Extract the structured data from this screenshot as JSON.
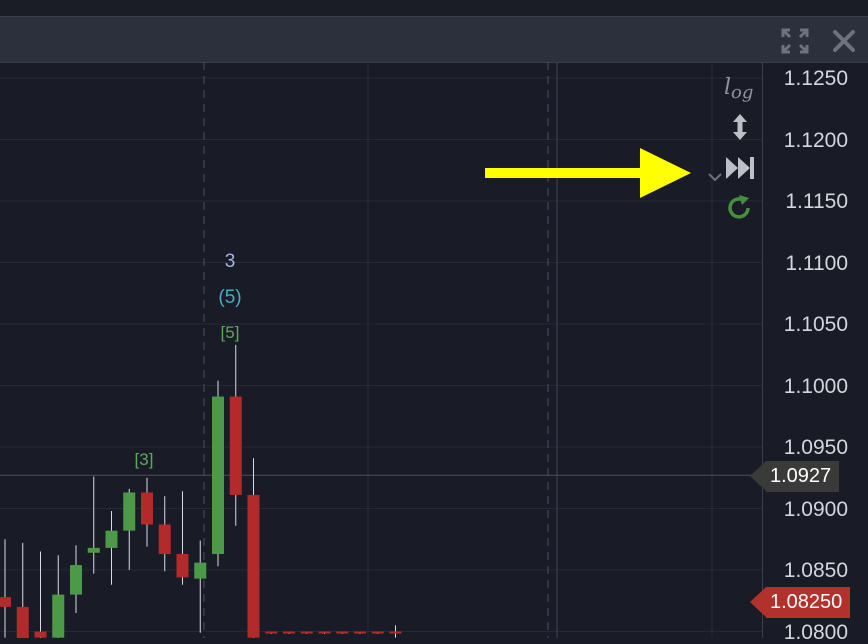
{
  "window": {
    "expand_icon": "expand-arrows-icon",
    "close_icon": "close-icon"
  },
  "axis": {
    "labels": [
      "1.1250",
      "1.1200",
      "1.1150",
      "1.1100",
      "1.1050",
      "1.1000",
      "1.0950",
      "1.0900",
      "1.0850",
      "1.0800"
    ],
    "current_price": "1.0927",
    "last_price": "1.08250"
  },
  "controls": {
    "log_label": "log",
    "resize_icon": "vertical-resize-arrows-icon",
    "chevron_icon": "chevron-down-icon",
    "skip_icon": "skip-to-end-icon",
    "refresh_icon": "refresh-icon"
  },
  "annotation": {
    "arrow_icon": "yellow-pointer-arrow-icon",
    "arrow_color": "#ffff00"
  },
  "wave_labels": {
    "primary": "3",
    "intermediate": "(5)",
    "minor": "[5]",
    "minor_earlier": "[3]"
  },
  "colors": {
    "up": "#4c9a48",
    "down": "#b22a2a",
    "background": "#191c27",
    "grid": "#262a36"
  },
  "chart_data": {
    "type": "candlestick",
    "ylim": [
      1.079,
      1.1265
    ],
    "y_ticks": [
      1.125,
      1.12,
      1.115,
      1.11,
      1.105,
      1.1,
      1.095,
      1.09,
      1.085,
      1.08
    ],
    "current_price": 1.0927,
    "last_price": 1.0825,
    "candles": [
      {
        "o": 1.0828,
        "h": 1.0875,
        "l": 1.0795,
        "c": 1.082
      },
      {
        "o": 1.082,
        "h": 1.0872,
        "l": 1.078,
        "c": 1.079
      },
      {
        "o": 1.08,
        "h": 1.0865,
        "l": 1.0788,
        "c": 1.0795
      },
      {
        "o": 1.0795,
        "h": 1.0862,
        "l": 1.0788,
        "c": 1.083
      },
      {
        "o": 1.083,
        "h": 1.087,
        "l": 1.0815,
        "c": 1.0854
      },
      {
        "o": 1.0864,
        "h": 1.0926,
        "l": 1.0847,
        "c": 1.0868
      },
      {
        "o": 1.0868,
        "h": 1.0898,
        "l": 1.0838,
        "c": 1.0882
      },
      {
        "o": 1.0882,
        "h": 1.0916,
        "l": 1.085,
        "c": 1.0913
      },
      {
        "o": 1.0913,
        "h": 1.0925,
        "l": 1.0869,
        "c": 1.0887
      },
      {
        "o": 1.0887,
        "h": 1.091,
        "l": 1.0849,
        "c": 1.0863
      },
      {
        "o": 1.0863,
        "h": 1.0914,
        "l": 1.0838,
        "c": 1.0844
      },
      {
        "o": 1.0843,
        "h": 1.0874,
        "l": 1.0799,
        "c": 1.0856
      },
      {
        "o": 1.0863,
        "h": 1.1004,
        "l": 1.0853,
        "c": 1.0991
      },
      {
        "o": 1.0991,
        "h": 1.1033,
        "l": 1.0886,
        "c": 1.0911
      },
      {
        "o": 1.0911,
        "h": 1.0941,
        "l": 1.0789,
        "c": 1.0795
      },
      {
        "o": 1.08,
        "h": 1.08,
        "l": 1.0798,
        "c": 1.0799
      },
      {
        "o": 1.08,
        "h": 1.08,
        "l": 1.0798,
        "c": 1.0799
      },
      {
        "o": 1.08,
        "h": 1.08,
        "l": 1.0798,
        "c": 1.0799
      },
      {
        "o": 1.08,
        "h": 1.08,
        "l": 1.0798,
        "c": 1.0799
      },
      {
        "o": 1.08,
        "h": 1.08,
        "l": 1.0798,
        "c": 1.0799
      },
      {
        "o": 1.08,
        "h": 1.08,
        "l": 1.0798,
        "c": 1.0799
      },
      {
        "o": 1.08,
        "h": 1.08,
        "l": 1.0798,
        "c": 1.0799
      },
      {
        "o": 1.08,
        "h": 1.0805,
        "l": 1.0795,
        "c": 1.0799
      }
    ]
  }
}
